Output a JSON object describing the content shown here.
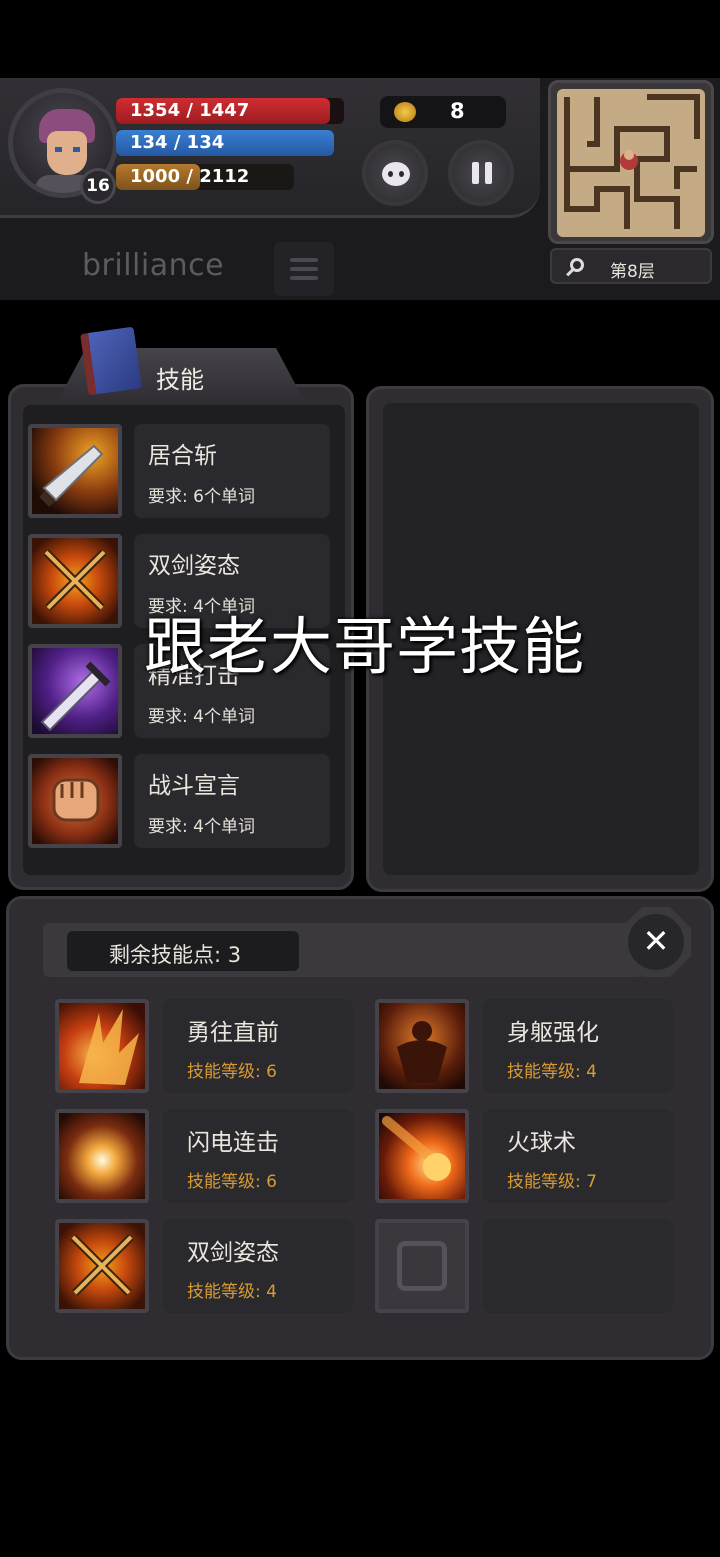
{
  "hud": {
    "level": "16",
    "hp": {
      "text": "1354 / 1447",
      "fraction": 0.94
    },
    "mp": {
      "text": "134 / 134",
      "fraction": 1.0
    },
    "xp": {
      "text_current": "1000",
      "text_sep": " / ",
      "text_max": "2112",
      "fraction": 0.47
    },
    "gold": "8",
    "floor": "第8层",
    "word": "brilliance"
  },
  "skill_book": {
    "title": "技能",
    "skills": [
      {
        "name": "居合斩",
        "requirement": "要求: 6个单词",
        "icon": "blade-skill-icon"
      },
      {
        "name": "双剑姿态",
        "requirement": "要求: 4个单词",
        "icon": "crossed-swords-icon"
      },
      {
        "name": "精准打击",
        "requirement": "要求: 4个单词",
        "icon": "purple-sword-icon"
      },
      {
        "name": "战斗宣言",
        "requirement": "要求: 4个单词",
        "icon": "fist-icon"
      }
    ]
  },
  "learned": {
    "points_label": "剩余技能点: 3",
    "close_symbol": "✕",
    "items": [
      {
        "name": "勇往直前",
        "level": "技能等级: 6",
        "icon": "flame-claw-icon"
      },
      {
        "name": "身躯强化",
        "level": "技能等级: 4",
        "icon": "body-strength-icon"
      },
      {
        "name": "闪电连击",
        "level": "技能等级: 6",
        "icon": "flash-icon"
      },
      {
        "name": "火球术",
        "level": "技能等级: 7",
        "icon": "fireball-icon"
      },
      {
        "name": "双剑姿态",
        "level": "技能等级: 4",
        "icon": "crossed-swords-icon"
      }
    ]
  },
  "caption": "跟老大哥学技能",
  "colors": {
    "hp": "#cf2d32",
    "mp": "#3a7fd0",
    "xp": "#b57a2e",
    "level_text": "#d79b32"
  }
}
